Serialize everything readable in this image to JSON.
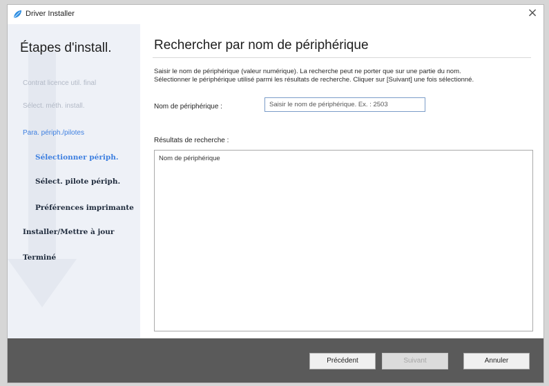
{
  "window": {
    "title": "Driver Installer",
    "close_glyph": "×",
    "app_icon": "driver-installer-icon"
  },
  "sidebar": {
    "title": "Étapes d'install.",
    "steps": [
      {
        "label": "Contrat licence util. final",
        "state": "done"
      },
      {
        "label": "Sélect. méth. install.",
        "state": "done"
      },
      {
        "label": "Para. périph./pilotes",
        "state": "current-group"
      },
      {
        "label": "Sélectionner périph.",
        "state": "current"
      },
      {
        "label": "Sélect. pilote périph.",
        "state": "pending"
      },
      {
        "label": "Préférences imprimante",
        "state": "pending"
      },
      {
        "label": "Installer/Mettre à jour",
        "state": "pending"
      },
      {
        "label": "Terminé",
        "state": "pending"
      }
    ]
  },
  "main": {
    "heading": "Rechercher par nom de périphérique",
    "instruction_line1": "Saisir le nom de périphérique (valeur numérique). La recherche peut ne porter que sur une partie du nom.",
    "instruction_line2": "Sélectionner le périphérique utilisé parmi les résultats de recherche. Cliquer sur [Suivant] une fois sélectionné.",
    "device_name_label": "Nom de périphérique :",
    "device_name_value": "",
    "device_name_placeholder": "Saisir le nom de périphérique. Ex. : 2503",
    "results_label": "Résultats de recherche :",
    "results_column_header": "Nom de périphérique"
  },
  "footer": {
    "prev_label": "Précédent",
    "next_label": "Suivant",
    "cancel_label": "Annuler",
    "next_enabled": false
  },
  "colors": {
    "accent": "#3d7fe0",
    "sidebar_bg": "#eef1f7",
    "footer_bg": "#5a5a5a"
  }
}
